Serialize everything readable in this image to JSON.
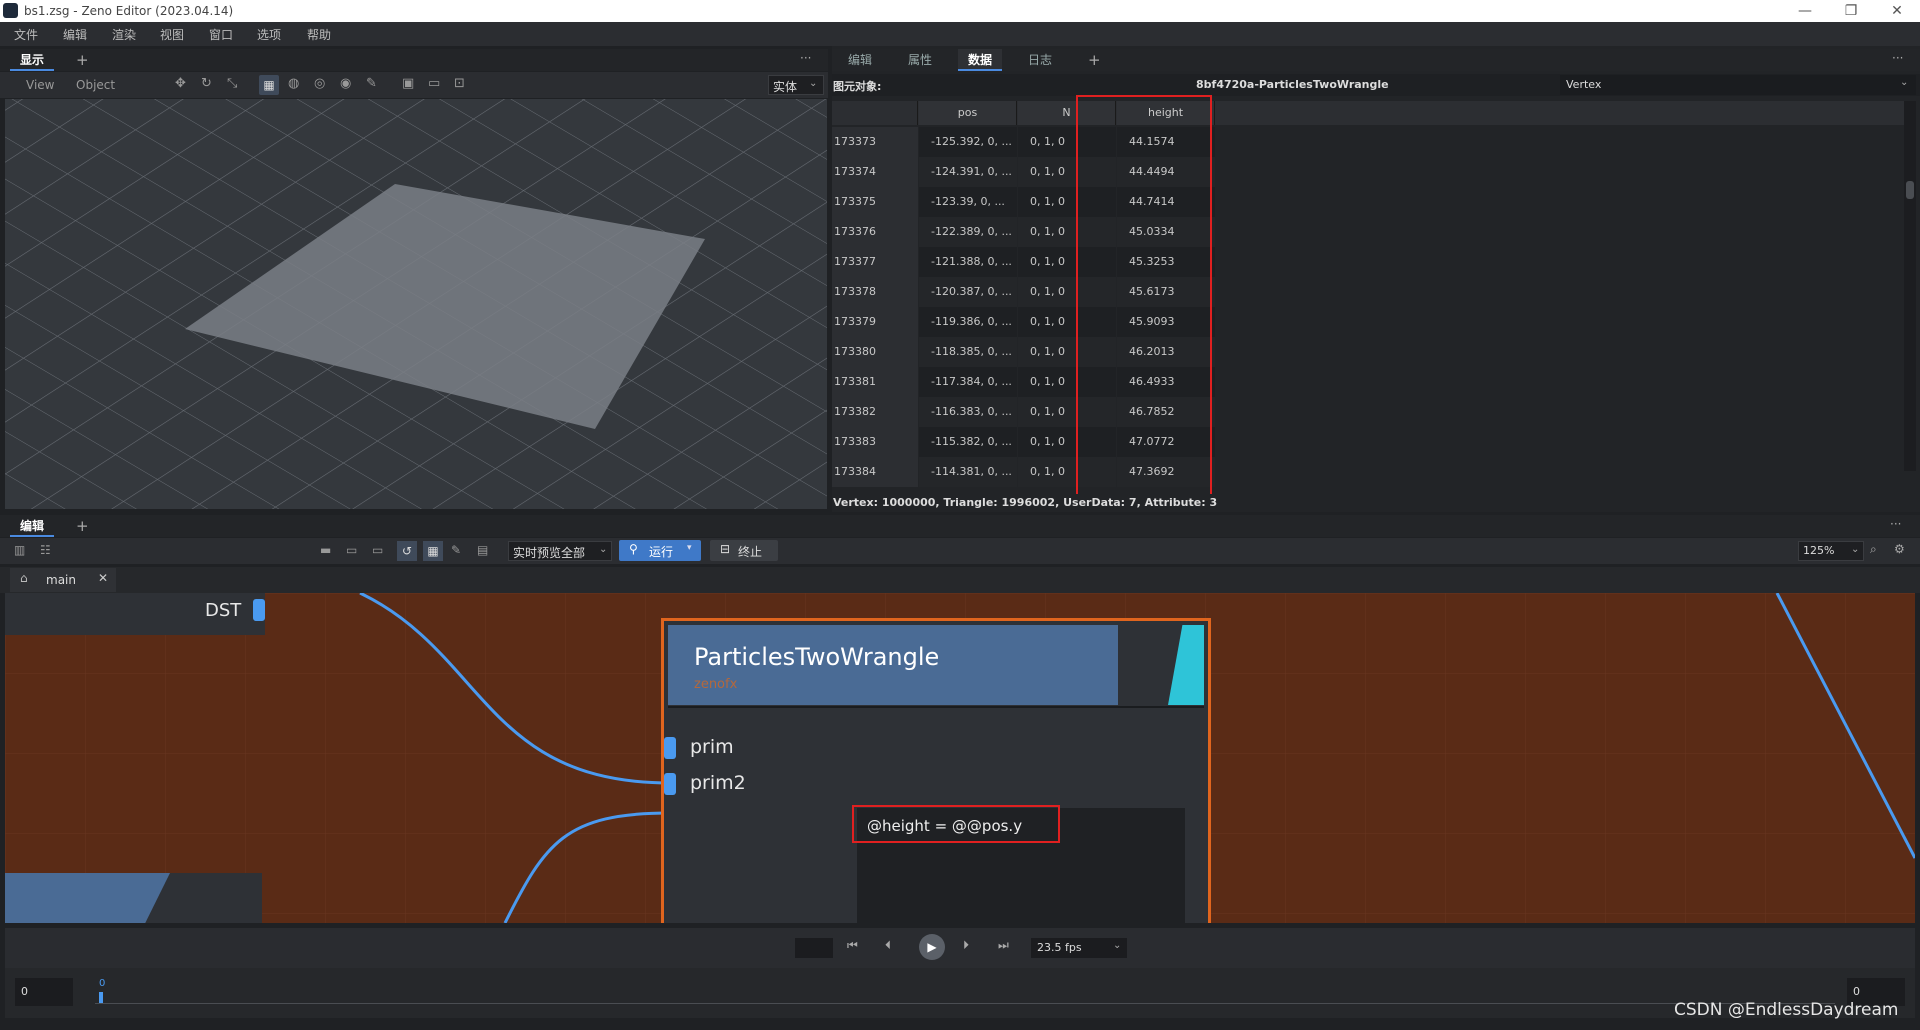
{
  "window": {
    "title": "bs1.zsg - Zeno Editor (2023.04.14)",
    "controls": [
      "—",
      "❐",
      "✕"
    ]
  },
  "menu": [
    "文件",
    "编辑",
    "渲染",
    "视图",
    "窗口",
    "选项",
    "帮助"
  ],
  "view_panel": {
    "tab": "显示",
    "add": "+",
    "more": "···",
    "view_label": "View",
    "object_label": "Object",
    "mode_select": "实体",
    "icons": [
      "move-icon",
      "rotate-icon",
      "scale-icon",
      "grid-icon",
      "palette-icon",
      "globe-icon",
      "sphere-icon",
      "brush-icon",
      "screenshot-icon",
      "camera-icon",
      "fit-icon"
    ]
  },
  "data_panel": {
    "tabs": [
      "编辑",
      "属性",
      "数据",
      "日志"
    ],
    "active_tab": "数据",
    "add": "+",
    "more": "···",
    "object_label": "图元对象:",
    "object_id": "8bf4720a-ParticlesTwoWrangle",
    "type_select": "Vertex",
    "columns": [
      "pos",
      "N",
      "height"
    ],
    "rows": [
      {
        "id": "173373",
        "pos": "-125.392, 0, ...",
        "n": "0, 1, 0",
        "height": "44.1574"
      },
      {
        "id": "173374",
        "pos": "-124.391, 0, ...",
        "n": "0, 1, 0",
        "height": "44.4494"
      },
      {
        "id": "173375",
        "pos": "-123.39, 0, ...",
        "n": "0, 1, 0",
        "height": "44.7414"
      },
      {
        "id": "173376",
        "pos": "-122.389, 0, ...",
        "n": "0, 1, 0",
        "height": "45.0334"
      },
      {
        "id": "173377",
        "pos": "-121.388, 0, ...",
        "n": "0, 1, 0",
        "height": "45.3253"
      },
      {
        "id": "173378",
        "pos": "-120.387, 0, ...",
        "n": "0, 1, 0",
        "height": "45.6173"
      },
      {
        "id": "173379",
        "pos": "-119.386, 0, ...",
        "n": "0, 1, 0",
        "height": "45.9093"
      },
      {
        "id": "173380",
        "pos": "-118.385, 0, ...",
        "n": "0, 1, 0",
        "height": "46.2013"
      },
      {
        "id": "173381",
        "pos": "-117.384, 0, ...",
        "n": "0, 1, 0",
        "height": "46.4933"
      },
      {
        "id": "173382",
        "pos": "-116.383, 0, ...",
        "n": "0, 1, 0",
        "height": "46.7852"
      },
      {
        "id": "173383",
        "pos": "-115.382, 0, ...",
        "n": "0, 1, 0",
        "height": "47.0772"
      },
      {
        "id": "173384",
        "pos": "-114.381, 0, ...",
        "n": "0, 1, 0",
        "height": "47.3692"
      }
    ],
    "status": "Vertex: 1000000, Triangle: 1996002, UserData: 7, Attribute: 3"
  },
  "editor_panel": {
    "tab": "编辑",
    "add": "+",
    "more": "···",
    "preview_select": "实时预览全部",
    "run_label": "运行",
    "stop_label": "终止",
    "zoom": "125%",
    "subgraph_tab": "main",
    "dst_label": "DST",
    "node": {
      "title": "ParticlesTwoWrangle",
      "subtitle": "zenofx",
      "inputs": [
        "prim",
        "prim2"
      ],
      "code": "@height = @@pos.y"
    }
  },
  "timeline": {
    "frame_input": "0",
    "current_frame": "0",
    "end_frame": "0",
    "fps": "23.5 fps"
  },
  "watermark": "CSDN @EndlessDaydream",
  "colors": {
    "accent": "#4a8ae0",
    "node_border": "#e0651e",
    "graph_bg": "#5a2b16",
    "highlight_box": "#e02020",
    "node_header": "#4a6b95",
    "node_stripe": "#2ec4d8"
  }
}
